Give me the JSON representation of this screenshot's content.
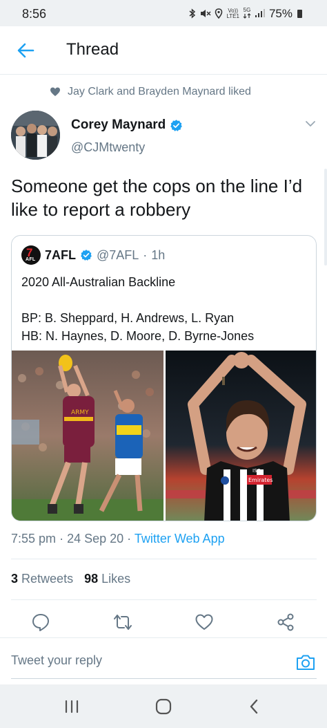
{
  "status_bar": {
    "time": "8:56",
    "volte_top": "Vo))",
    "volte_bottom": "LTE1",
    "network_top": "5G",
    "battery_percent": "75%"
  },
  "header": {
    "title": "Thread"
  },
  "social_context": {
    "text": "Jay Clark and Brayden Maynard liked"
  },
  "tweet": {
    "author_name": "Corey Maynard",
    "author_handle": "@CJMtwenty",
    "text": "Someone get the cops on the line I’d like to report a robbery",
    "time": "7:55 pm",
    "date": "24 Sep 20",
    "source": "Twitter Web App",
    "separator": "·",
    "retweets_count": "3",
    "retweets_label": "Retweets",
    "likes_count": "98",
    "likes_label": "Likes"
  },
  "quoted_tweet": {
    "logo_text": "7",
    "logo_subtext": "AFL",
    "name": "7AFL",
    "handle": "@7AFL",
    "separator": "·",
    "time": "1h",
    "lines": [
      "2020 All-Australian Backline",
      "",
      "BP: B. Sheppard, H. Andrews, L. Ryan",
      "HB: N. Haynes, D. Moore, D. Byrne-Jones"
    ],
    "left_image_label": "ARMY",
    "right_image_sponsor": "Emirates",
    "right_image_brand": "ISC"
  },
  "reply": {
    "placeholder": "Tweet your reply"
  },
  "colors": {
    "accent": "#1da1f2",
    "text_primary": "#14171a",
    "text_secondary": "#657786",
    "divider": "#e6ecf0"
  },
  "icons": {
    "back": "arrow-left-icon",
    "liked": "heart-icon",
    "verified": "verified-badge-icon",
    "menu": "chevron-down-icon",
    "reply": "reply-icon",
    "retweet": "retweet-icon",
    "like": "heart-icon",
    "share": "share-icon",
    "camera": "camera-icon"
  }
}
